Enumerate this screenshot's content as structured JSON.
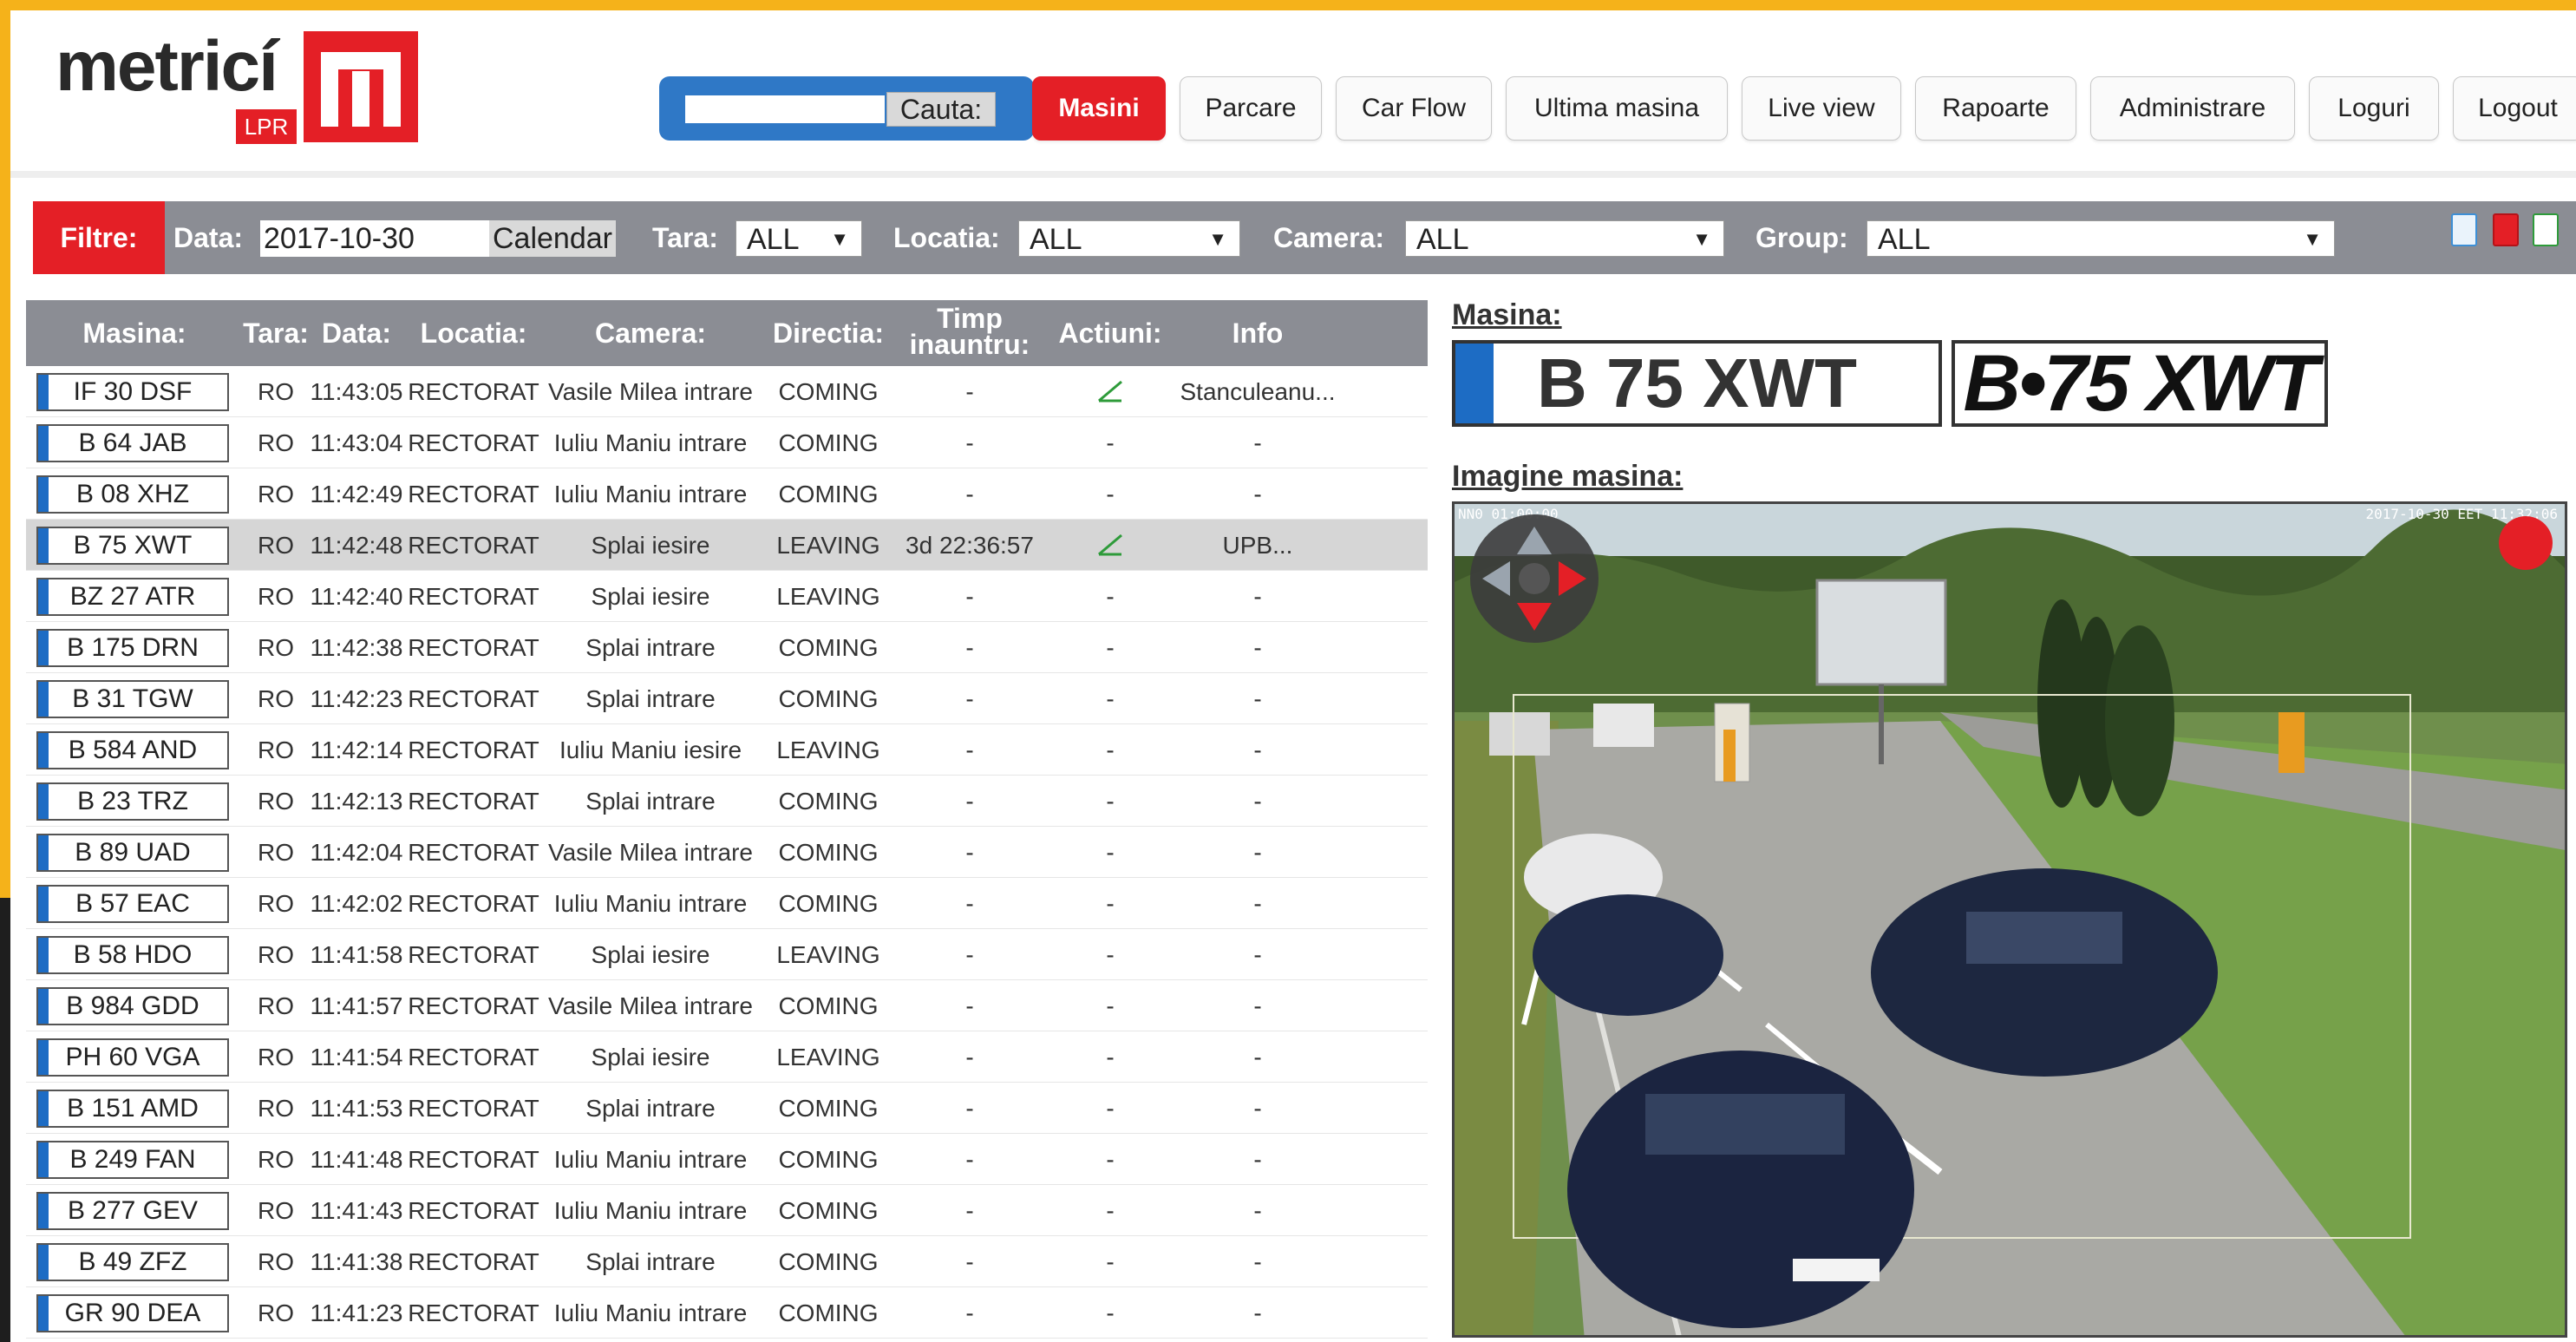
{
  "logo": {
    "name": "metricí",
    "sub": "LPR"
  },
  "search": {
    "value": "",
    "button": "Cauta:"
  },
  "nav": [
    "Masini",
    "Parcare",
    "Car Flow",
    "Ultima masina",
    "Live view",
    "Rapoarte",
    "Administrare",
    "Loguri",
    "Logout"
  ],
  "filter": {
    "label": "Filtre:",
    "date_label": "Data:",
    "date_value": "2017-10-30",
    "calendar": "Calendar",
    "tara_label": "Tara:",
    "tara_value": "ALL",
    "locatia_label": "Locatia:",
    "locatia_value": "ALL",
    "camera_label": "Camera:",
    "camera_value": "ALL",
    "group_label": "Group:",
    "group_value": "ALL",
    "icons": [
      "doc-icon",
      "pdf-icon",
      "excel-icon"
    ]
  },
  "table": {
    "headers": {
      "masina": "Masina:",
      "tara": "Tara:",
      "data": "Data:",
      "locatia": "Locatia:",
      "camera": "Camera:",
      "directia": "Directia:",
      "timp1": "Timp",
      "timp2": "inauntru:",
      "actiuni": "Actiuni:",
      "info": "Info"
    },
    "rows": [
      {
        "plate": "IF 30 DSF",
        "tara": "RO",
        "data": "11:43:05",
        "loc": "RECTORAT",
        "cam": "Vasile Milea intrare",
        "dir": "COMING",
        "timp": "-",
        "act": "edit",
        "info": "Stanculeanu..."
      },
      {
        "plate": "B 64 JAB",
        "tara": "RO",
        "data": "11:43:04",
        "loc": "RECTORAT",
        "cam": "Iuliu Maniu intrare",
        "dir": "COMING",
        "timp": "-",
        "act": "-",
        "info": "-"
      },
      {
        "plate": "B 08 XHZ",
        "tara": "RO",
        "data": "11:42:49",
        "loc": "RECTORAT",
        "cam": "Iuliu Maniu intrare",
        "dir": "COMING",
        "timp": "-",
        "act": "-",
        "info": "-"
      },
      {
        "plate": "B 75 XWT",
        "tara": "RO",
        "data": "11:42:48",
        "loc": "RECTORAT",
        "cam": "Splai iesire",
        "dir": "LEAVING",
        "timp": "3d 22:36:57",
        "act": "edit",
        "info": "UPB..."
      },
      {
        "plate": "BZ 27 ATR",
        "tara": "RO",
        "data": "11:42:40",
        "loc": "RECTORAT",
        "cam": "Splai iesire",
        "dir": "LEAVING",
        "timp": "-",
        "act": "-",
        "info": "-"
      },
      {
        "plate": "B 175 DRN",
        "tara": "RO",
        "data": "11:42:38",
        "loc": "RECTORAT",
        "cam": "Splai intrare",
        "dir": "COMING",
        "timp": "-",
        "act": "-",
        "info": "-"
      },
      {
        "plate": "B 31 TGW",
        "tara": "RO",
        "data": "11:42:23",
        "loc": "RECTORAT",
        "cam": "Splai intrare",
        "dir": "COMING",
        "timp": "-",
        "act": "-",
        "info": "-"
      },
      {
        "plate": "B 584 AND",
        "tara": "RO",
        "data": "11:42:14",
        "loc": "RECTORAT",
        "cam": "Iuliu Maniu iesire",
        "dir": "LEAVING",
        "timp": "-",
        "act": "-",
        "info": "-"
      },
      {
        "plate": "B 23 TRZ",
        "tara": "RO",
        "data": "11:42:13",
        "loc": "RECTORAT",
        "cam": "Splai intrare",
        "dir": "COMING",
        "timp": "-",
        "act": "-",
        "info": "-"
      },
      {
        "plate": "B 89 UAD",
        "tara": "RO",
        "data": "11:42:04",
        "loc": "RECTORAT",
        "cam": "Vasile Milea intrare",
        "dir": "COMING",
        "timp": "-",
        "act": "-",
        "info": "-"
      },
      {
        "plate": "B 57 EAC",
        "tara": "RO",
        "data": "11:42:02",
        "loc": "RECTORAT",
        "cam": "Iuliu Maniu intrare",
        "dir": "COMING",
        "timp": "-",
        "act": "-",
        "info": "-"
      },
      {
        "plate": "B 58 HDO",
        "tara": "RO",
        "data": "11:41:58",
        "loc": "RECTORAT",
        "cam": "Splai iesire",
        "dir": "LEAVING",
        "timp": "-",
        "act": "-",
        "info": "-"
      },
      {
        "plate": "B 984 GDD",
        "tara": "RO",
        "data": "11:41:57",
        "loc": "RECTORAT",
        "cam": "Vasile Milea intrare",
        "dir": "COMING",
        "timp": "-",
        "act": "-",
        "info": "-"
      },
      {
        "plate": "PH 60 VGA",
        "tara": "RO",
        "data": "11:41:54",
        "loc": "RECTORAT",
        "cam": "Splai iesire",
        "dir": "LEAVING",
        "timp": "-",
        "act": "-",
        "info": "-"
      },
      {
        "plate": "B 151 AMD",
        "tara": "RO",
        "data": "11:41:53",
        "loc": "RECTORAT",
        "cam": "Splai intrare",
        "dir": "COMING",
        "timp": "-",
        "act": "-",
        "info": "-"
      },
      {
        "plate": "B 249 FAN",
        "tara": "RO",
        "data": "11:41:48",
        "loc": "RECTORAT",
        "cam": "Iuliu Maniu intrare",
        "dir": "COMING",
        "timp": "-",
        "act": "-",
        "info": "-"
      },
      {
        "plate": "B 277 GEV",
        "tara": "RO",
        "data": "11:41:43",
        "loc": "RECTORAT",
        "cam": "Iuliu Maniu intrare",
        "dir": "COMING",
        "timp": "-",
        "act": "-",
        "info": "-"
      },
      {
        "plate": "B 49 ZFZ",
        "tara": "RO",
        "data": "11:41:38",
        "loc": "RECTORAT",
        "cam": "Splai intrare",
        "dir": "COMING",
        "timp": "-",
        "act": "-",
        "info": "-"
      },
      {
        "plate": "GR 90 DEA",
        "tara": "RO",
        "data": "11:41:23",
        "loc": "RECTORAT",
        "cam": "Iuliu Maniu intrare",
        "dir": "COMING",
        "timp": "-",
        "act": "-",
        "info": "-"
      }
    ],
    "selected_index": 3
  },
  "detail": {
    "masina_label": "Masina:",
    "plate_text": "B 75 XWT",
    "plate_crop": "B•75 XWT",
    "image_label": "Imagine masina:",
    "cam_ts_left": "NN0 01:00:00",
    "cam_ts_right": "2017-10-30 EET 11:32:06"
  },
  "colors": {
    "brand_red": "#e41f26",
    "accent_blue": "#2f78c6",
    "filter_gray": "#8b8d94",
    "frame": "#f5b21a",
    "edit_green": "#2e9b3a"
  }
}
